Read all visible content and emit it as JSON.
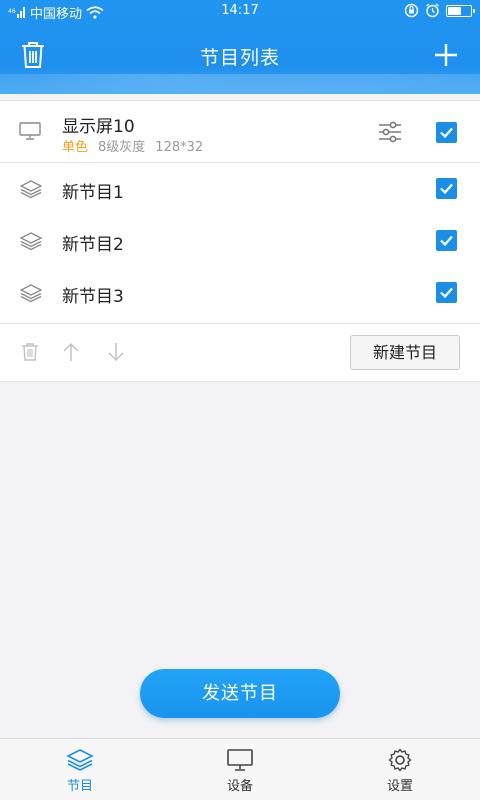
{
  "status_bar": {
    "carrier": "中国移动",
    "time": "14:17",
    "battery_level": 0.55
  },
  "header": {
    "title": "节目列表",
    "left_icon": "trash-icon",
    "right_icon": "plus-icon"
  },
  "display": {
    "name": "显示屏10",
    "color_mode": "单色",
    "gray_level": "8级灰度",
    "resolution": "128*32",
    "checked": true
  },
  "programs": [
    {
      "label": "新节目1",
      "checked": true
    },
    {
      "label": "新节目2",
      "checked": true
    },
    {
      "label": "新节目3",
      "checked": true
    }
  ],
  "actions": {
    "new_program_label": "新建节目"
  },
  "send_button_label": "发送节目",
  "bottom_nav": {
    "items": [
      {
        "label": "节目",
        "icon": "layers-icon",
        "active": true
      },
      {
        "label": "设备",
        "icon": "monitor-icon",
        "active": false
      },
      {
        "label": "设置",
        "icon": "gear-icon",
        "active": false
      }
    ]
  },
  "colors": {
    "primary": "#1b8fe6",
    "accent_orange": "#f0a11e"
  }
}
